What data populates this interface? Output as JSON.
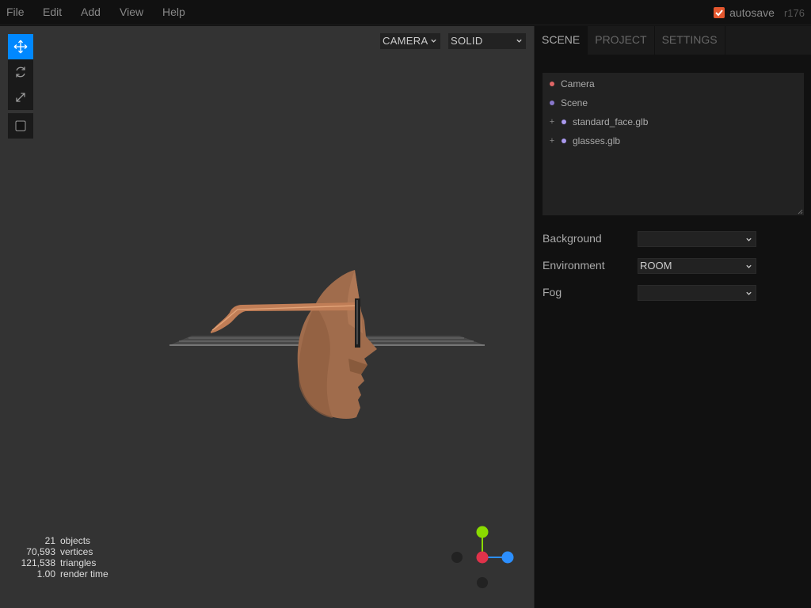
{
  "menubar": {
    "items": [
      "File",
      "Edit",
      "Add",
      "View",
      "Help"
    ],
    "autosave_label": "autosave",
    "autosave_checked": true,
    "version": "r176"
  },
  "viewport": {
    "camera_select": "CAMERA",
    "shading_select": "SOLID",
    "tools": [
      "move-icon",
      "rotate-icon",
      "scale-icon",
      "square-icon"
    ],
    "active_tool": "move",
    "stats": [
      {
        "value": "21",
        "label": "objects"
      },
      {
        "value": "70,593",
        "label": "vertices"
      },
      {
        "value": "121,538",
        "label": "triangles"
      },
      {
        "value": "1.00",
        "label": "render time"
      }
    ]
  },
  "sidebar": {
    "tabs": [
      "SCENE",
      "PROJECT",
      "SETTINGS"
    ],
    "active_tab": "SCENE",
    "outliner": [
      {
        "name": "Camera",
        "expandable": false,
        "color": "#e06666"
      },
      {
        "name": "Scene",
        "expandable": false,
        "color": "#8877cc"
      },
      {
        "name": "standard_face.glb",
        "expandable": true,
        "opener": "+",
        "color": "#aa99ee"
      },
      {
        "name": "glasses.glb",
        "expandable": true,
        "opener": "+",
        "color": "#aa99ee"
      }
    ],
    "properties": [
      {
        "label": "Background",
        "value": ""
      },
      {
        "label": "Environment",
        "value": "ROOM"
      },
      {
        "label": "Fog",
        "value": ""
      }
    ]
  },
  "colors": {
    "accent": "#0088ff",
    "autosave_check": "#e4572e",
    "axis_x": "#ff3653",
    "axis_y": "#8adb00",
    "axis_z": "#2c8fff"
  }
}
